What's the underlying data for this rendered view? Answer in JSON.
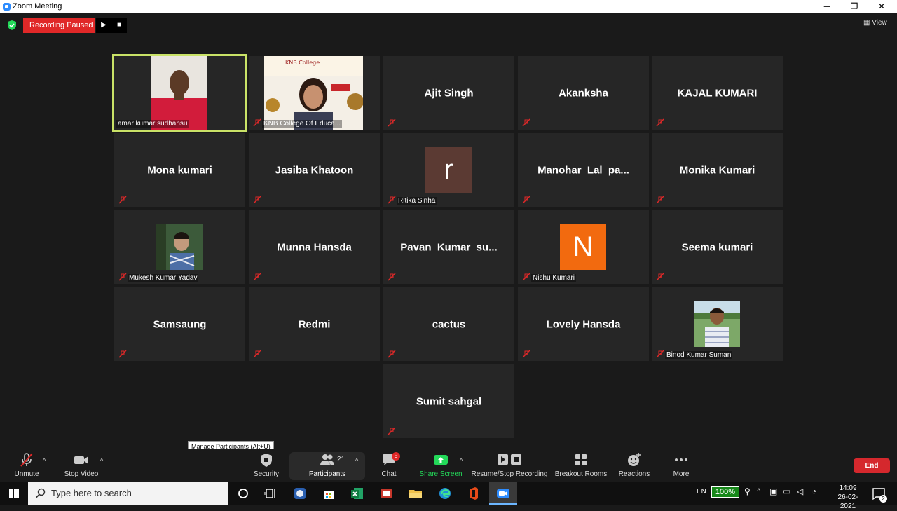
{
  "window": {
    "title": "Zoom Meeting",
    "minimize": "─",
    "maximize": "❐",
    "close": "✕"
  },
  "topbar": {
    "recording_status": "Recording Paused",
    "view_label": "View",
    "view_icon": "grid-icon"
  },
  "participants": [
    {
      "name": "amar kumar sudhansu",
      "type": "video",
      "active": true
    },
    {
      "name": "KNB College Of Educa...",
      "type": "video"
    },
    {
      "name": "Ajit Singh",
      "type": "name"
    },
    {
      "name": "Akanksha",
      "type": "name"
    },
    {
      "name": "KAJAL KUMARI",
      "type": "name"
    },
    {
      "name": "Mona kumari",
      "type": "name"
    },
    {
      "name": "Jasiba Khatoon",
      "type": "name"
    },
    {
      "name": "Ritika Sinha",
      "type": "avatar",
      "letter": "r",
      "color": "#5b3a33"
    },
    {
      "name": "Manohar  Lal  pa...",
      "type": "name"
    },
    {
      "name": "Monika Kumari",
      "type": "name"
    },
    {
      "name": "Mukesh Kumar Yadav",
      "type": "photo"
    },
    {
      "name": "Munna Hansda",
      "type": "name"
    },
    {
      "name": "Pavan  Kumar  su...",
      "type": "name"
    },
    {
      "name": "Nishu Kumari",
      "type": "avatar",
      "letter": "N",
      "color": "#f26a0f"
    },
    {
      "name": "Seema kumari",
      "type": "name"
    },
    {
      "name": "Samsaung",
      "type": "name"
    },
    {
      "name": "Redmi",
      "type": "name"
    },
    {
      "name": "cactus",
      "type": "name"
    },
    {
      "name": "Lovely Hansda",
      "type": "name"
    },
    {
      "name": "Binod Kumar Suman",
      "type": "photo"
    },
    {
      "name": "Sumit sahgal",
      "type": "name"
    }
  ],
  "tooltip": "Manage Participants (Alt+U)",
  "toolbar": {
    "unmute": "Unmute",
    "stop_video": "Stop Video",
    "security": "Security",
    "participants": "Participants",
    "participants_count": "21",
    "chat": "Chat",
    "chat_badge": "5",
    "share_screen": "Share Screen",
    "recording": "Resume/Stop Recording",
    "breakout": "Breakout Rooms",
    "reactions": "Reactions",
    "more": "More",
    "end": "End"
  },
  "taskbar": {
    "search_placeholder": "Type here to search",
    "language": "EN",
    "battery": "100%",
    "time": "14:09",
    "date": "26-02-2021",
    "notifications": "2"
  },
  "colors": {
    "accent_green": "#23d959",
    "end_red": "#d5282d",
    "rec_red": "#e02828",
    "active_border": "#c9e267"
  }
}
